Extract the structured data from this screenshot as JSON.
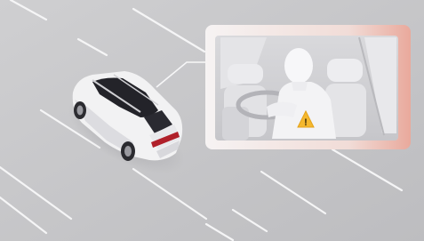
{
  "scene": {
    "description_hidden": "",
    "road_color": "#c4c4c6",
    "lane_marking_color": "#ffffff",
    "car_color": "#f2f2f2",
    "car_window_color": "#1f1f24",
    "car_taillight_color": "#b0202a",
    "callout_frame_color": "#f7ecea",
    "callout_gradient_accent": "#e8a79d",
    "warning_color": "#f5b82e",
    "warning_symbol": "!"
  }
}
